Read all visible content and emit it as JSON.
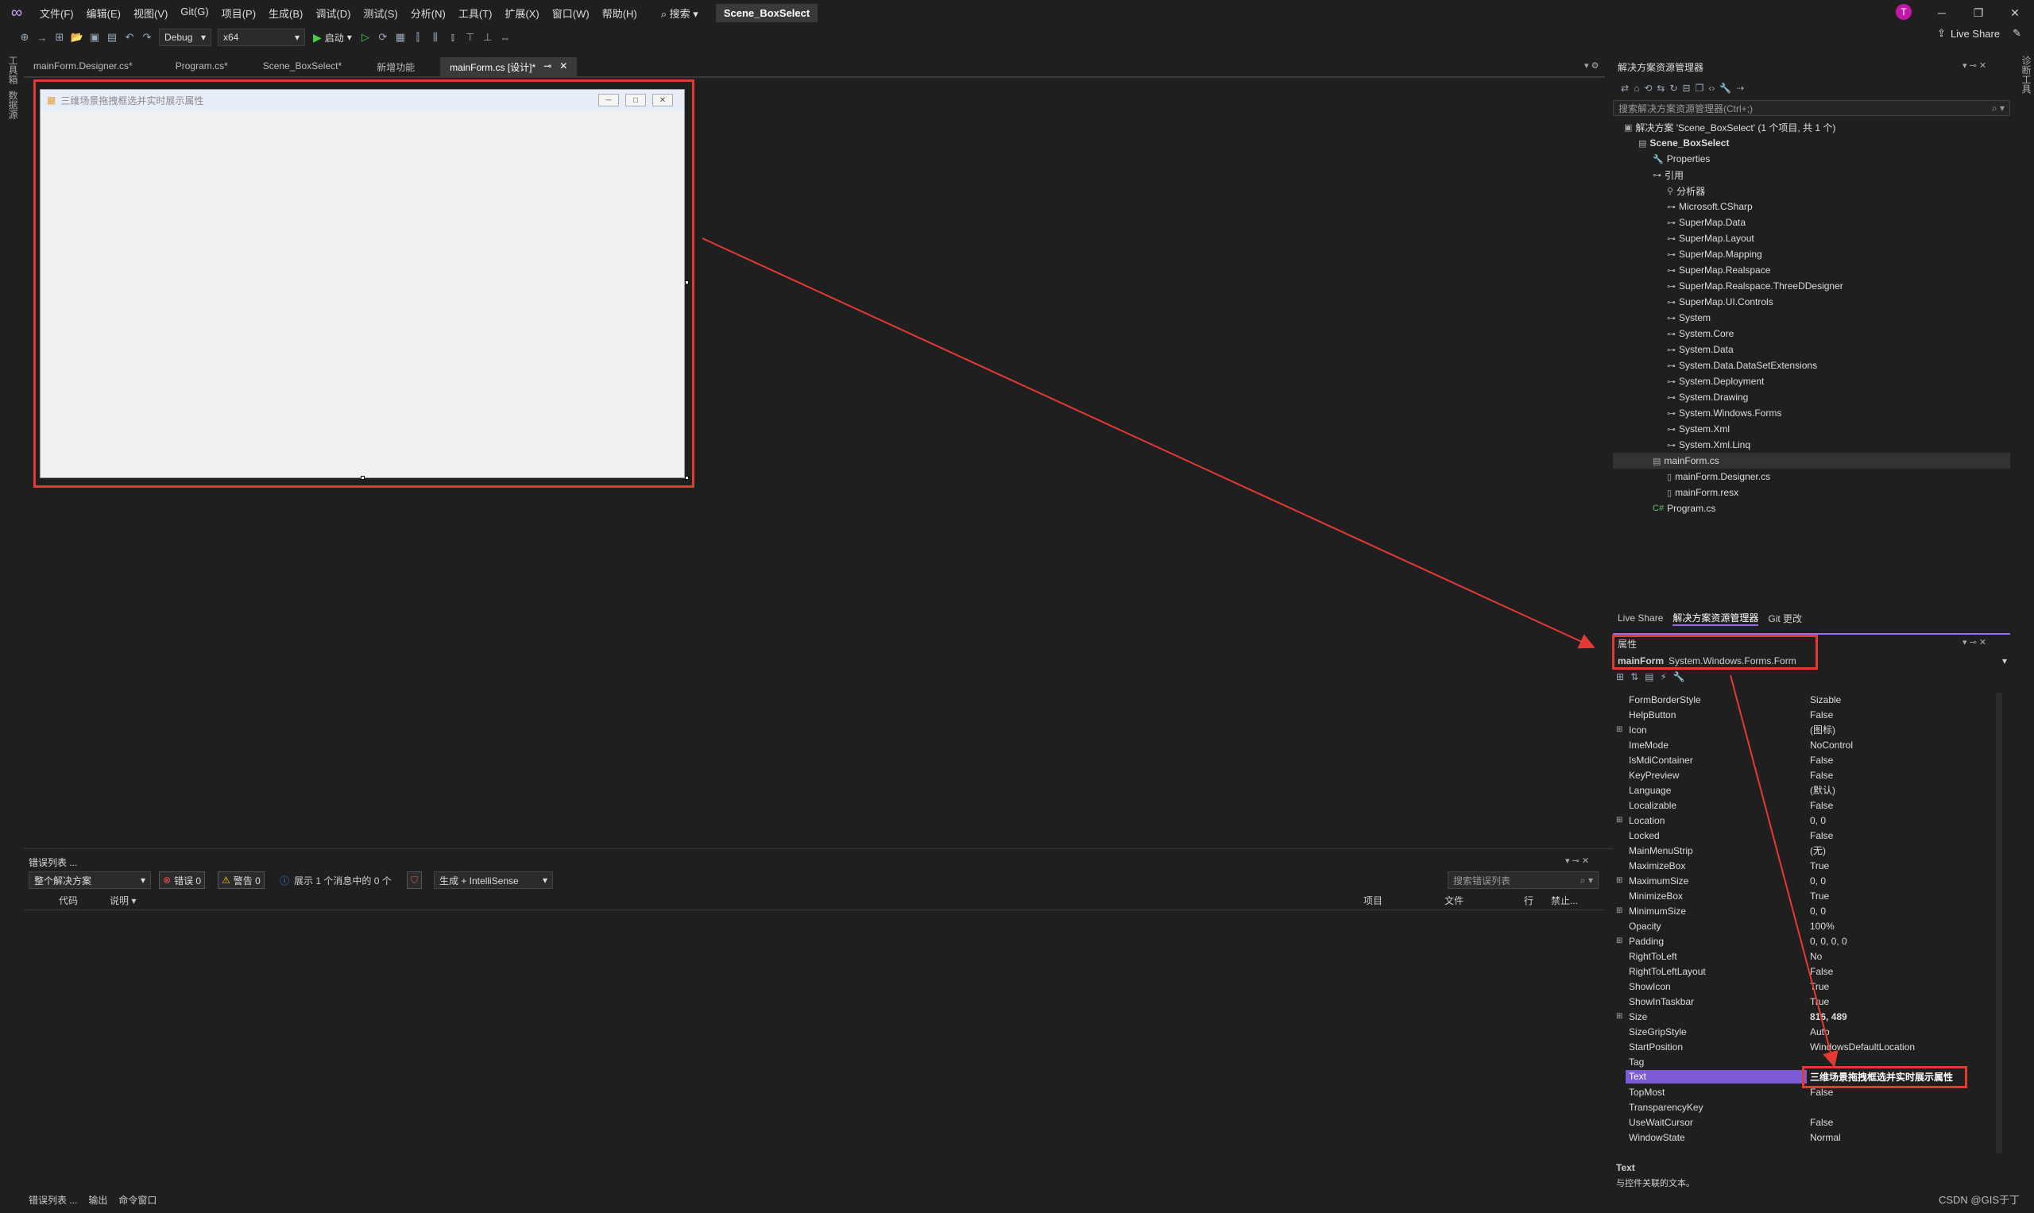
{
  "menubar": {
    "items": [
      "文件(F)",
      "编辑(E)",
      "视图(V)",
      "Git(G)",
      "项目(P)",
      "生成(B)",
      "调试(D)",
      "测试(S)",
      "分析(N)",
      "工具(T)",
      "扩展(X)",
      "窗口(W)",
      "帮助(H)"
    ],
    "search": "搜索",
    "solution_title": "Scene_BoxSelect",
    "avatar_letter": "T"
  },
  "toolbar": {
    "config": "Debug",
    "platform": "x64",
    "start_label": "启动",
    "live_share": "Live Share"
  },
  "left_strip": {
    "tab1": "工具箱",
    "tab2": "数据源"
  },
  "right_strip": {
    "tab1": "诊断工具"
  },
  "doc_tabs": [
    {
      "label": "mainForm.Designer.cs*"
    },
    {
      "label": "Program.cs*"
    },
    {
      "label": "Scene_BoxSelect*"
    },
    {
      "label": "新增功能"
    },
    {
      "label": "mainForm.cs [设计]*"
    }
  ],
  "form_preview": {
    "title": "三维场景拖拽框选并实时展示属性"
  },
  "error_list": {
    "title": "错误列表 ...",
    "scope": "整个解决方案",
    "errors": "错误 0",
    "warnings": "警告 0",
    "messages": "展示 1 个消息中的 0 个",
    "build_filter": "生成 + IntelliSense",
    "search_placeholder": "搜索错误列表",
    "col_code": "代码",
    "col_desc": "说明",
    "col_project": "项目",
    "col_file": "文件",
    "col_line": "行",
    "col_suppress": "禁止..."
  },
  "bottom_tabs": [
    "错误列表 ...",
    "输出",
    "命令窗口"
  ],
  "solution_explorer": {
    "title": "解决方案资源管理器",
    "search_placeholder": "搜索解决方案资源管理器(Ctrl+;)",
    "tree": [
      {
        "label": "解决方案 'Scene_BoxSelect' (1 个项目, 共 1 个)",
        "level": 0,
        "icon": "solution-icon"
      },
      {
        "label": "Scene_BoxSelect",
        "level": 1,
        "icon": "project-icon",
        "bold": true
      },
      {
        "label": "Properties",
        "level": 2,
        "icon": "wrench-icon"
      },
      {
        "label": "引用",
        "level": 2,
        "icon": "references-icon"
      },
      {
        "label": "分析器",
        "level": 3,
        "icon": "analyzer-icon"
      },
      {
        "label": "Microsoft.CSharp",
        "level": 3,
        "icon": "reference-icon"
      },
      {
        "label": "SuperMap.Data",
        "level": 3,
        "icon": "reference-icon"
      },
      {
        "label": "SuperMap.Layout",
        "level": 3,
        "icon": "reference-icon"
      },
      {
        "label": "SuperMap.Mapping",
        "level": 3,
        "icon": "reference-icon"
      },
      {
        "label": "SuperMap.Realspace",
        "level": 3,
        "icon": "reference-icon"
      },
      {
        "label": "SuperMap.Realspace.ThreeDDesigner",
        "level": 3,
        "icon": "reference-icon"
      },
      {
        "label": "SuperMap.UI.Controls",
        "level": 3,
        "icon": "reference-icon"
      },
      {
        "label": "System",
        "level": 3,
        "icon": "reference-icon"
      },
      {
        "label": "System.Core",
        "level": 3,
        "icon": "reference-icon"
      },
      {
        "label": "System.Data",
        "level": 3,
        "icon": "reference-icon"
      },
      {
        "label": "System.Data.DataSetExtensions",
        "level": 3,
        "icon": "reference-icon"
      },
      {
        "label": "System.Deployment",
        "level": 3,
        "icon": "reference-icon"
      },
      {
        "label": "System.Drawing",
        "level": 3,
        "icon": "reference-icon"
      },
      {
        "label": "System.Windows.Forms",
        "level": 3,
        "icon": "reference-icon"
      },
      {
        "label": "System.Xml",
        "level": 3,
        "icon": "reference-icon"
      },
      {
        "label": "System.Xml.Linq",
        "level": 3,
        "icon": "reference-icon"
      },
      {
        "label": "mainForm.cs",
        "level": 2,
        "icon": "form-icon",
        "selected": true
      },
      {
        "label": "mainForm.Designer.cs",
        "level": 3,
        "icon": "file-icon"
      },
      {
        "label": "mainForm.resx",
        "level": 3,
        "icon": "file-icon"
      },
      {
        "label": "Program.cs",
        "level": 2,
        "icon": "csharp-icon"
      }
    ]
  },
  "se_tabs": [
    "Live Share",
    "解决方案资源管理器",
    "Git 更改"
  ],
  "properties": {
    "title": "属性",
    "object_name": "mainForm",
    "object_type": "System.Windows.Forms.Form",
    "rows": [
      {
        "name": "FormBorderStyle",
        "value": "Sizable"
      },
      {
        "name": "HelpButton",
        "value": "False"
      },
      {
        "name": "Icon",
        "value": "(图标)",
        "expand": true
      },
      {
        "name": "ImeMode",
        "value": "NoControl"
      },
      {
        "name": "IsMdiContainer",
        "value": "False"
      },
      {
        "name": "KeyPreview",
        "value": "False"
      },
      {
        "name": "Language",
        "value": "(默认)"
      },
      {
        "name": "Localizable",
        "value": "False"
      },
      {
        "name": "Location",
        "value": "0, 0",
        "expand": true
      },
      {
        "name": "Locked",
        "value": "False"
      },
      {
        "name": "MainMenuStrip",
        "value": "(无)"
      },
      {
        "name": "MaximizeBox",
        "value": "True"
      },
      {
        "name": "MaximumSize",
        "value": "0, 0",
        "expand": true
      },
      {
        "name": "MinimizeBox",
        "value": "True"
      },
      {
        "name": "MinimumSize",
        "value": "0, 0",
        "expand": true
      },
      {
        "name": "Opacity",
        "value": "100%"
      },
      {
        "name": "Padding",
        "value": "0, 0, 0, 0",
        "expand": true
      },
      {
        "name": "RightToLeft",
        "value": "No"
      },
      {
        "name": "RightToLeftLayout",
        "value": "False"
      },
      {
        "name": "ShowIcon",
        "value": "True"
      },
      {
        "name": "ShowInTaskbar",
        "value": "True"
      },
      {
        "name": "Size",
        "value": "816, 489",
        "expand": true,
        "bold": true
      },
      {
        "name": "SizeGripStyle",
        "value": "Auto"
      },
      {
        "name": "StartPosition",
        "value": "WindowsDefaultLocation"
      },
      {
        "name": "Tag",
        "value": ""
      },
      {
        "name": "Text",
        "value": "三维场景拖拽框选并实时展示属性",
        "selected": true,
        "bold": true
      },
      {
        "name": "TopMost",
        "value": "False"
      },
      {
        "name": "TransparencyKey",
        "value": ""
      },
      {
        "name": "UseWaitCursor",
        "value": "False"
      },
      {
        "name": "WindowState",
        "value": "Normal"
      }
    ],
    "desc_title": "Text",
    "desc_text": "与控件关联的文本。"
  },
  "watermark": "CSDN @GIS于丁",
  "colors": {
    "annotation_red": "#e53935",
    "accent_purple": "#9b6bf2"
  }
}
